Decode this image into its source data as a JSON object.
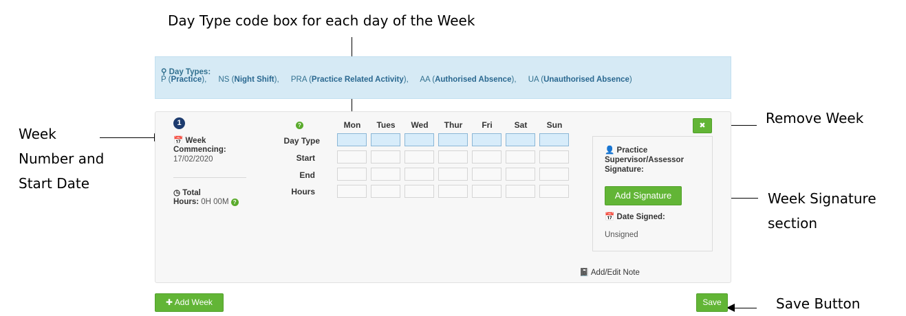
{
  "annotations": {
    "top": "Day Type code box for each day of the Week",
    "week_number_line1": "Week",
    "week_number_line2": "Number and",
    "week_number_line3": "Start Date",
    "remove_week": "Remove Week",
    "week_signature_line1": "Week Signature",
    "week_signature_line2": "section",
    "save_button": "Save Button"
  },
  "banner": {
    "title": "Day Types:",
    "items": [
      {
        "code": "P",
        "name": "Practice",
        "sep": "),"
      },
      {
        "code": "NS",
        "name": "Night Shift",
        "sep": "),"
      },
      {
        "code": "PRA",
        "name": "Practice Related Activity",
        "sep": "),"
      },
      {
        "code": "AA",
        "name": "Authorised Absence",
        "sep": "),"
      },
      {
        "code": "UA",
        "name": "Unauthorised Absence",
        "sep": ")"
      }
    ]
  },
  "week": {
    "number": "1",
    "commencing_label_1": "Week",
    "commencing_label_2": "Commencing:",
    "commencing_date": "17/02/2020",
    "total_label_1": "Total",
    "total_label_2": "Hours:",
    "total_value": "0H 00M"
  },
  "grid": {
    "days": [
      "Mon",
      "Tues",
      "Wed",
      "Thur",
      "Fri",
      "Sat",
      "Sun"
    ],
    "rows": [
      "Day Type",
      "Start",
      "End",
      "Hours"
    ]
  },
  "signature": {
    "label_1": "Practice",
    "label_2": "Supervisor/Assessor",
    "label_3": "Signature:",
    "add_button": "Add Signature",
    "date_label": "Date Signed:",
    "date_value": "Unsigned"
  },
  "actions": {
    "add_note": "Add/Edit Note",
    "add_week": "Add Week",
    "save": "Save",
    "remove_icon": "✖"
  },
  "colors": {
    "banner_bg": "#d6eaf5",
    "accent_green": "#62b536",
    "badge_navy": "#1d3b6e",
    "daytype_cell": "#d7ecfa"
  }
}
